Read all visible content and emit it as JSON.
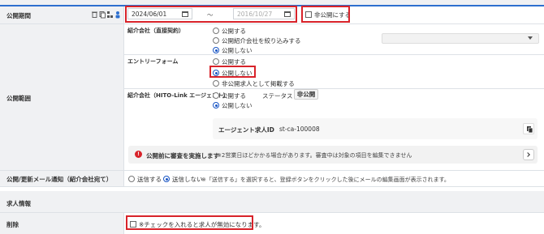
{
  "publish_period": {
    "label": "公開期間",
    "start_date": "2024/06/01",
    "tilde": "〜",
    "end_placeholder": "2016/10/27",
    "private_label": "非公開にする",
    "icons": [
      "trash-icon",
      "copy-icon",
      "network-icon",
      "person-icon"
    ]
  },
  "publish_scope": {
    "label": "公開範囲",
    "introducer": {
      "title": "紹介会社（直接契約）",
      "options": [
        "公開する",
        "公開紹介会社を絞り込みする",
        "公開しない"
      ],
      "selected": 2
    },
    "entry_form": {
      "title": "エントリーフォーム",
      "options": [
        "公開する",
        "公開しない",
        "非公開求人として掲載する"
      ],
      "selected": 1
    },
    "hitolink": {
      "title": "紹介会社（HITO-Link エージェント）",
      "options": [
        "公開する",
        "公開しない"
      ],
      "selected": 1,
      "status_label": "ステータス",
      "status_value": "非公開",
      "agent_id_label": "エージェント求人ID",
      "agent_id_value": "st-ca-100008"
    },
    "review_notice": {
      "bold": "公開前に審査を実施します",
      "text": "※2営業日ほどかかる場合があります。審査中は対象の項目を編集できません"
    }
  },
  "mail_notify": {
    "label": "公開/更新メール通知（紹介会社宛て）",
    "send": "送信する",
    "no_send": "送信しない",
    "note": "※「送信する」を選択すると、登録ボタンをクリックした後にメールの編集画面が表示されます。"
  },
  "job_info": {
    "section_title": "求人情報",
    "delete_label": "削除",
    "delete_check": "※チェックを入れると求人が無効になります。"
  }
}
